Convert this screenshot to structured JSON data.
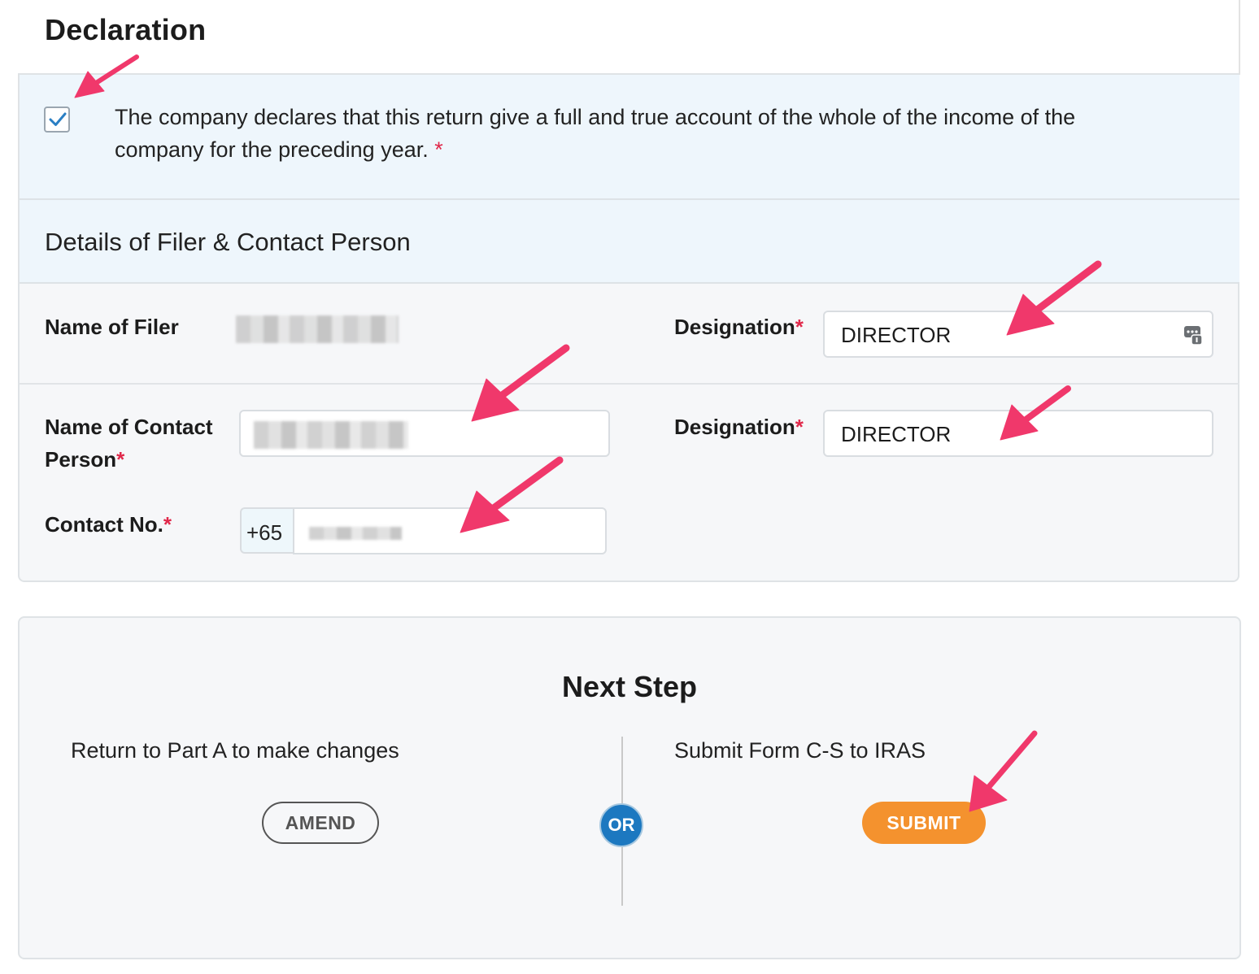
{
  "declaration": {
    "title": "Declaration",
    "checkbox_checked": true,
    "statement": "The company declares that this return give a full and true account of the whole of the income of the company for the preceding year.",
    "required_mark": "*"
  },
  "details": {
    "title": "Details of Filer & Contact Person",
    "name_of_filer_label": "Name of Filer",
    "filer_designation_label": "Designation",
    "filer_designation_value": "DIRECTOR",
    "contact_person_label_line1": "Name of Contact",
    "contact_person_label_line2": "Person",
    "contact_designation_label": "Designation",
    "contact_designation_value": "DIRECTOR",
    "contact_no_label": "Contact No.",
    "country_code": "+65"
  },
  "next_step": {
    "title": "Next Step",
    "amend_description": "Return to Part A to make changes",
    "amend_label": "AMEND",
    "or_label": "OR",
    "submit_description": "Submit Form C-S to IRAS",
    "submit_label": "SUBMIT"
  },
  "colors": {
    "accent_blue": "#1c78c0",
    "submit_orange": "#f4922e",
    "required_red": "#e0284a",
    "annotation_pink": "#f0386b"
  }
}
